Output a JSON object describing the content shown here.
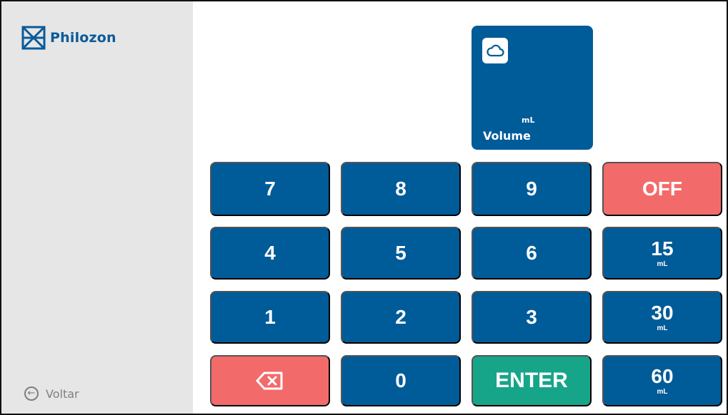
{
  "brand": {
    "name": "Philozon"
  },
  "sidebar": {
    "back_label": "Voltar"
  },
  "volume_tile": {
    "unit": "mL",
    "label": "Volume",
    "icon": "cloud-icon"
  },
  "keypad": {
    "keys": [
      "7",
      "8",
      "9",
      "4",
      "5",
      "6",
      "1",
      "2",
      "3",
      "0"
    ],
    "off_label": "OFF",
    "enter_label": "ENTER",
    "backspace_icon": "backspace-icon",
    "presets": [
      {
        "value": "15",
        "unit": "mL"
      },
      {
        "value": "30",
        "unit": "mL"
      },
      {
        "value": "60",
        "unit": "mL"
      }
    ]
  },
  "colors": {
    "primary": "#005b99",
    "danger": "#f26b6a",
    "success": "#17a589",
    "sidebar": "#e6e6e6"
  }
}
